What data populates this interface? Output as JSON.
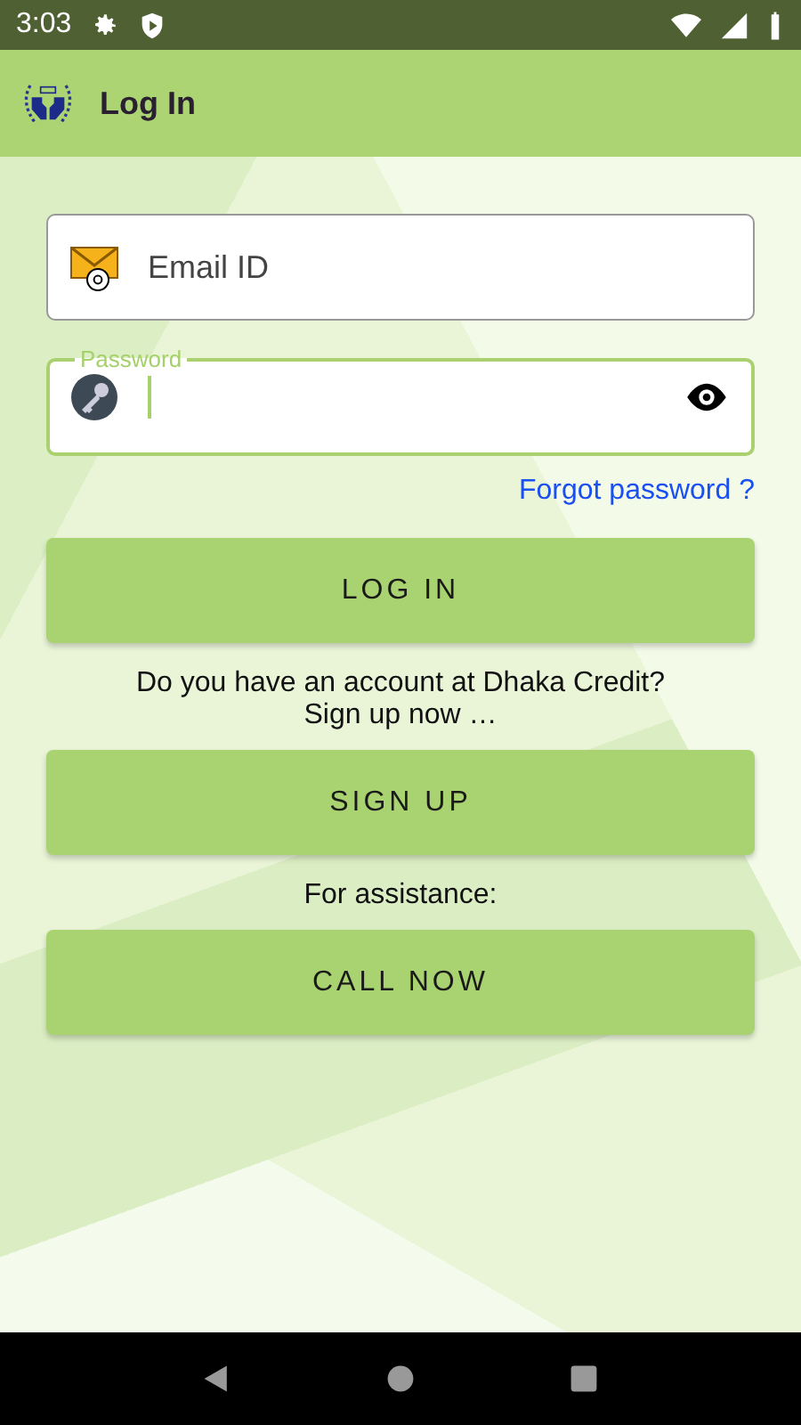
{
  "status_bar": {
    "time": "3:03"
  },
  "app_bar": {
    "title": "Log In"
  },
  "email_field": {
    "placeholder": "Email ID"
  },
  "password_field": {
    "label": "Password",
    "focused": true
  },
  "forgot_link": "Forgot password ?",
  "login_button": "LOG IN",
  "signup_prompt": "Do you have an account at Dhaka Credit?\nSign up now …",
  "signup_button": "SIGN UP",
  "assistance_text": "For assistance:",
  "call_button": "CALL NOW"
}
